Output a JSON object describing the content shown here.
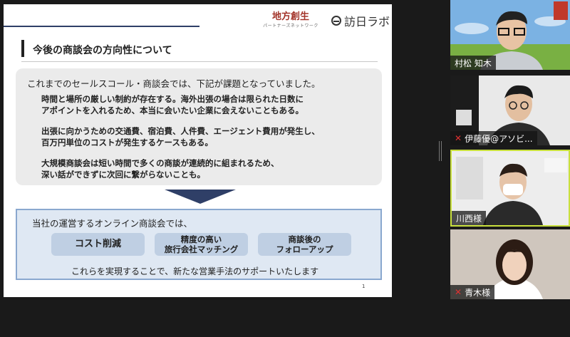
{
  "slide": {
    "logo_chiho_main": "地方創生",
    "logo_chiho_sub": "パートナーズネットワーク",
    "logo_houjitsu": "訪日ラボ",
    "heading": "今後の商談会の方向性について",
    "issues_intro": "これまでのセールスコール・商談会では、下記が課題となっていました。",
    "issues": [
      {
        "line1": "時間と場所の厳しい制約が存在する。海外出張の場合は限られた日数に",
        "line2": "アポイントを入れるため、本当に会いたい企業に会えないこともある。"
      },
      {
        "line1": "出張に向かうための交通費、宿泊費、人件費、エージェント費用が発生し、",
        "line2": "百万円単位のコストが発生するケースもある。"
      },
      {
        "line1": "大規模商談会は短い時間で多くの商談が連続的に組まれるため、",
        "line2": "深い話ができずに次回に繋がらないことも。"
      }
    ],
    "solution_intro": "当社の運営するオンライン商談会では、",
    "pills": [
      {
        "line1": "コスト削減",
        "line2": ""
      },
      {
        "line1": "精度の高い",
        "line2": "旅行会社マッチング"
      },
      {
        "line1": "商談後の",
        "line2": "フォローアップ"
      }
    ],
    "solution_footer": "これらを実現することで、新たな営業手法のサポートいたします",
    "page_number": "1"
  },
  "participants": [
    {
      "name": "村松 知木",
      "muted": false
    },
    {
      "name": "伊藤優@アソビ...",
      "muted": true
    },
    {
      "name": "川西様",
      "muted": false,
      "active_speaker": true
    },
    {
      "name": "青木様",
      "muted": true
    }
  ],
  "colors": {
    "accent_navy": "#2f3f67",
    "active_speaker_border": "#c9e03d",
    "muted_mic": "#e03131"
  },
  "icons": {
    "muted_mic": "mic-muted-icon"
  }
}
